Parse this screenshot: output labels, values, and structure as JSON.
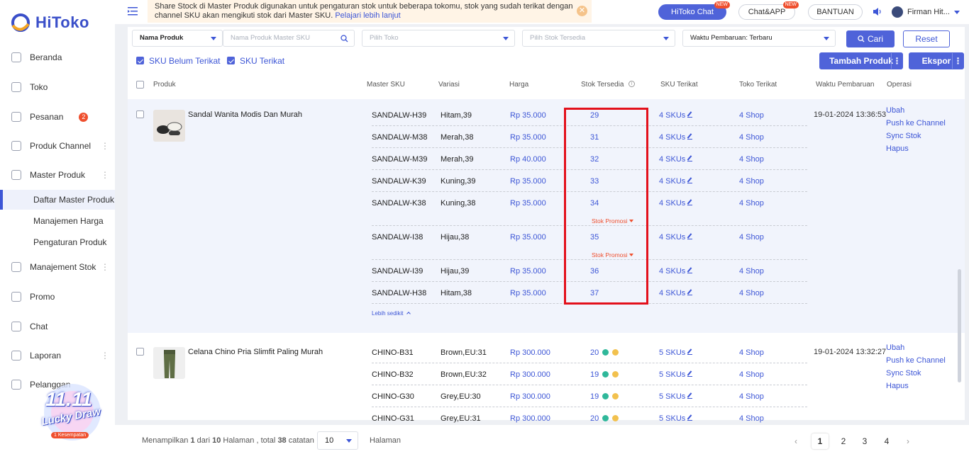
{
  "brand": {
    "name": "HiToko"
  },
  "sidebar": {
    "items": [
      {
        "label": "Beranda",
        "icon": "monitor-icon"
      },
      {
        "label": "Toko",
        "icon": "store-icon"
      },
      {
        "label": "Pesanan",
        "icon": "order-icon",
        "badge": "2"
      },
      {
        "label": "Produk Channel",
        "icon": "grid-icon"
      },
      {
        "label": "Master Produk",
        "icon": "box-icon"
      },
      {
        "label": "Manajement Stok",
        "icon": "stock-icon"
      },
      {
        "label": "Promo",
        "icon": "promo-icon"
      },
      {
        "label": "Chat",
        "icon": "chat-icon"
      },
      {
        "label": "Laporan",
        "icon": "report-icon"
      },
      {
        "label": "Pelanggan",
        "icon": "customer-icon"
      }
    ],
    "subitems": [
      "Daftar Master Produk",
      "Manajemen Harga",
      "Pengaturan Produk"
    ],
    "lucky_draw": {
      "title": "11.11",
      "subtitle": "Lucky Draw",
      "chance": "1 Kesempatan"
    }
  },
  "notice": {
    "text": "Share Stock di Master Produk digunakan untuk pengaturan stok untuk beberapa tokomu, stok yang sudah terikat dengan channel SKU akan mengikuti stok dari Master SKU.",
    "link": "Pelajari lebih lanjut"
  },
  "header": {
    "hitoko_chat": "HiToko Chat",
    "chat_app": "Chat&APP",
    "new_tag": "NEW",
    "help": "BANTUAN",
    "user": "Firman Hit..."
  },
  "filters": {
    "field": "Nama Produk",
    "search_placeholder": "Nama Produk Master SKU",
    "shop_placeholder": "Pilih Toko",
    "stock_placeholder": "Pilih Stok Tersedia",
    "sort": "Waktu Pembaruan: Terbaru",
    "search_btn": "Cari",
    "reset_btn": "Reset",
    "sku_unbound": "SKU Belum Terikat",
    "sku_bound": "SKU Terikat",
    "add_btn": "Tambah Produk",
    "export_btn": "Ekspor"
  },
  "columns": [
    "Produk",
    "Master SKU",
    "Variasi",
    "Harga",
    "Stok Tersedia",
    "SKU Terikat",
    "Toko Terikat",
    "Waktu Pembaruan",
    "Operasi"
  ],
  "products": [
    {
      "name": "Sandal Wanita Modis Dan Murah",
      "time": "19-01-2024 13:36:53",
      "collapse": "Lebih sedikit",
      "rows": [
        {
          "sku": "SANDALW-H39",
          "var": "Hitam,39",
          "price": "Rp 35.000",
          "stock": "29",
          "skus": "4 SKUs",
          "shop": "4 Shop"
        },
        {
          "sku": "SANDALW-M38",
          "var": "Merah,38",
          "price": "Rp 35.000",
          "stock": "31",
          "skus": "4 SKUs",
          "shop": "4 Shop"
        },
        {
          "sku": "SANDALW-M39",
          "var": "Merah,39",
          "price": "Rp 40.000",
          "stock": "32",
          "skus": "4 SKUs",
          "shop": "4 Shop"
        },
        {
          "sku": "SANDALW-K39",
          "var": "Kuning,39",
          "price": "Rp 35.000",
          "stock": "33",
          "skus": "4 SKUs",
          "shop": "4 Shop"
        },
        {
          "sku": "SANDALW-K38",
          "var": "Kuning,38",
          "price": "Rp 35.000",
          "stock": "34",
          "skus": "4 SKUs",
          "shop": "4 Shop",
          "promo": "Stok Promosi"
        },
        {
          "sku": "SANDALW-I38",
          "var": "Hijau,38",
          "price": "Rp 35.000",
          "stock": "35",
          "skus": "4 SKUs",
          "shop": "4 Shop",
          "promo": "Stok Promosi"
        },
        {
          "sku": "SANDALW-I39",
          "var": "Hijau,39",
          "price": "Rp 35.000",
          "stock": "36",
          "skus": "4 SKUs",
          "shop": "4 Shop"
        },
        {
          "sku": "SANDALW-H38",
          "var": "Hitam,38",
          "price": "Rp 35.000",
          "stock": "37",
          "skus": "4 SKUs",
          "shop": "4 Shop"
        }
      ]
    },
    {
      "name": "Celana Chino Pria Slimfit Paling Murah",
      "time": "19-01-2024 13:32:27",
      "rows": [
        {
          "sku": "CHINO-B31",
          "var": "Brown,EU:31",
          "price": "Rp 300.000",
          "stock": "20",
          "skus": "5 SKUs",
          "shop": "4 Shop"
        },
        {
          "sku": "CHINO-B32",
          "var": "Brown,EU:32",
          "price": "Rp 300.000",
          "stock": "19",
          "skus": "5 SKUs",
          "shop": "4 Shop"
        },
        {
          "sku": "CHINO-G30",
          "var": "Grey,EU:30",
          "price": "Rp 300.000",
          "stock": "19",
          "skus": "5 SKUs",
          "shop": "4 Shop"
        },
        {
          "sku": "CHINO-G31",
          "var": "Grey,EU:31",
          "price": "Rp 300.000",
          "stock": "20",
          "skus": "5 SKUs",
          "shop": "4 Shop"
        }
      ]
    }
  ],
  "operations": [
    "Ubah",
    "Push ke Channel",
    "Sync Stok",
    "Hapus"
  ],
  "footer": {
    "summary_prefix": "Menampilkan",
    "page": "1",
    "of": "dari",
    "pages": "10",
    "pages_label": "Halaman , total",
    "total": "38",
    "total_label": "catatan",
    "page_size": "10",
    "halaman": "Halaman",
    "page_numbers": [
      "1",
      "2",
      "3",
      "4"
    ]
  }
}
